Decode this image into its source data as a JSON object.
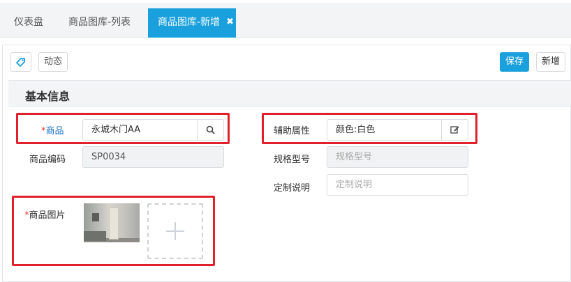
{
  "tabs": [
    {
      "label": "仪表盘"
    },
    {
      "label": "商品图库-列表"
    },
    {
      "label": "商品图库-新增",
      "close_glyph": "✖"
    }
  ],
  "toolbar": {
    "dynamic_label": "动态",
    "save_label": "保存",
    "new_label": "新增"
  },
  "section": {
    "title": "基本信息"
  },
  "form": {
    "product": {
      "required_mark": "*",
      "label": "商品",
      "value": "永城木门AA"
    },
    "aux_attr": {
      "label": "辅助属性",
      "value": "颜色:白色"
    },
    "product_code": {
      "label": "商品编码",
      "value": "SP0034"
    },
    "spec_model": {
      "label": "规格型号",
      "placeholder": "规格型号"
    },
    "custom_desc": {
      "label": "定制说明",
      "placeholder": "定制说明"
    },
    "product_image": {
      "required_mark": "*",
      "label": "商品图片"
    }
  },
  "colors": {
    "accent": "#1aa0dc",
    "highlight_box": "#e0202a",
    "required": "#e53935",
    "link_label": "#1a73c8"
  },
  "icons": {
    "tag": "tag-icon",
    "search": "search-icon",
    "edit": "edit-icon",
    "add": "plus-icon",
    "close": "close-icon"
  }
}
